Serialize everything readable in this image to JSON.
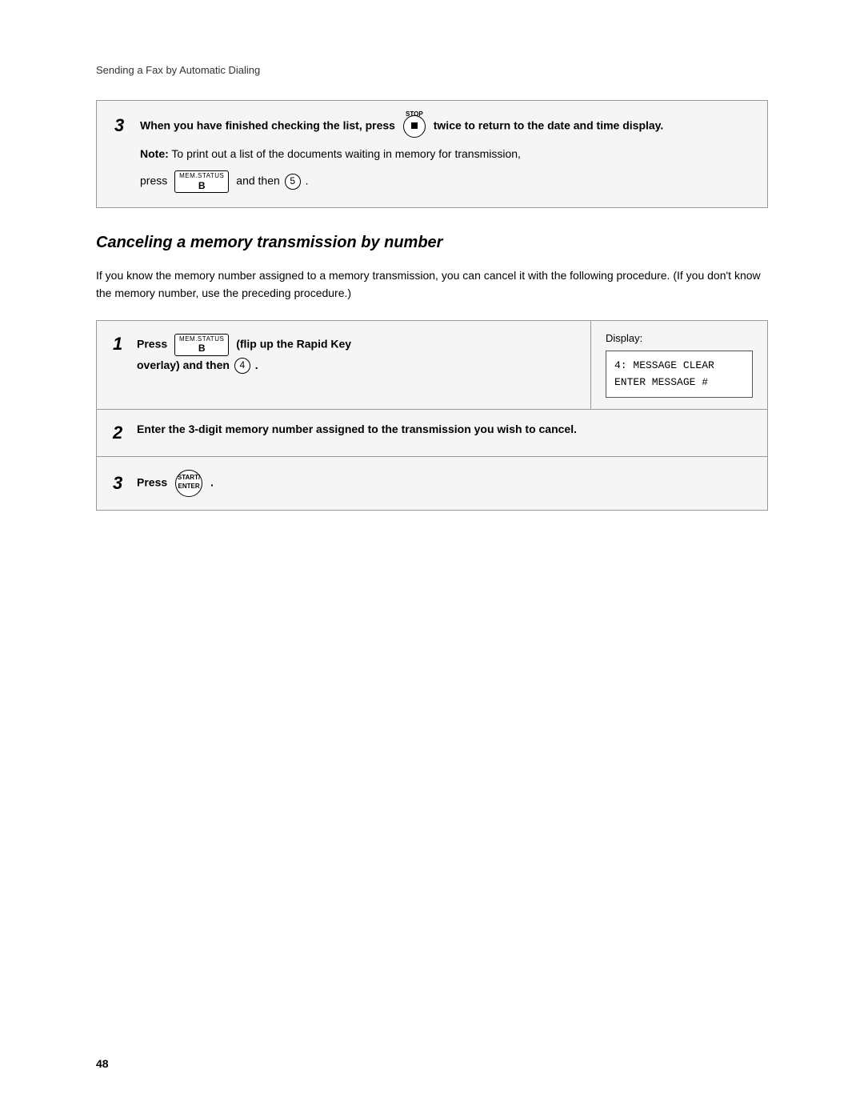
{
  "page": {
    "number": "48"
  },
  "breadcrumb": {
    "text": "Sending a Fax by Automatic Dialing"
  },
  "top_box": {
    "step_num": "3",
    "main_text_bold": "When you have finished checking the list, press",
    "stop_label": "STOP",
    "button_label": "",
    "suffix_bold": "twice to return to the date and time display.",
    "note_label": "Note:",
    "note_text": "To print out a list of the documents waiting in memory for transmission,",
    "press_label": "press",
    "mem_status_top": "MEM.STATUS",
    "mem_status_main": "B",
    "and_then_label": "and then",
    "five_num": "5"
  },
  "section": {
    "heading": "Canceling a memory transmission by number",
    "description": "If you know the memory number assigned to a memory transmission, you can cancel it with the following procedure. (If you don't know the memory number, use the preceding procedure.)"
  },
  "steps": [
    {
      "num": "1",
      "left_text_pre": "Press",
      "mem_status_top": "MEM.STATUS",
      "mem_status_main": "B",
      "left_text_mid": "(flip up the Rapid Key overlay) and then",
      "num_key": "4",
      "display_label": "Display:",
      "display_lines": [
        "4: MESSAGE CLEAR",
        "ENTER MESSAGE #"
      ]
    },
    {
      "num": "2",
      "full_text_bold": "Enter the 3-digit memory number assigned to the transmission you wish to cancel."
    },
    {
      "num": "3",
      "left_text_pre": "Press",
      "start_line1": "START/",
      "start_line2": "ENTER"
    }
  ]
}
